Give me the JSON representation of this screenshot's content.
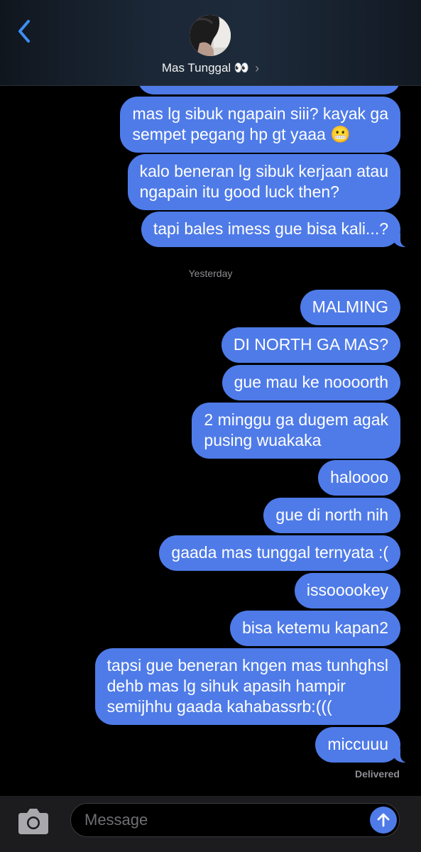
{
  "header": {
    "contact_name": "Mas Tunggal 👀",
    "back_icon": "chevron-left-icon",
    "info_icon": "chevron-right-icon"
  },
  "thread": {
    "messages_before": [
      "mas lg sibuk ngapain siii? kayak ga\nsempet pegang hp gt yaaa 😬",
      "kalo beneran lg sibuk kerjaan atau\nngapain itu good luck then?",
      "tapi bales imess gue bisa kali...?"
    ],
    "timestamp": "Yesterday",
    "messages_after": [
      "MALMING",
      "DI NORTH GA MAS?",
      "gue mau ke noooorth",
      "2 minggu ga dugem agak\npusing wuakaka",
      "haloooo",
      "gue di north nih",
      "gaada mas tunggal ternyata :(",
      "issooookey",
      "bisa ketemu kapan2",
      "tapsi gue beneran kngen mas tunhghsl\ndehb mas lg sihuk apasih hampir\nsemijhhu gaada kahabassrb:(((",
      "miccuuu"
    ],
    "status": "Delivered"
  },
  "composer": {
    "placeholder": "Message",
    "camera_icon": "camera-icon",
    "send_icon": "arrow-up-icon"
  },
  "colors": {
    "bubble": "#4f7be8",
    "accent": "#3d8ff5",
    "background": "#000000"
  }
}
